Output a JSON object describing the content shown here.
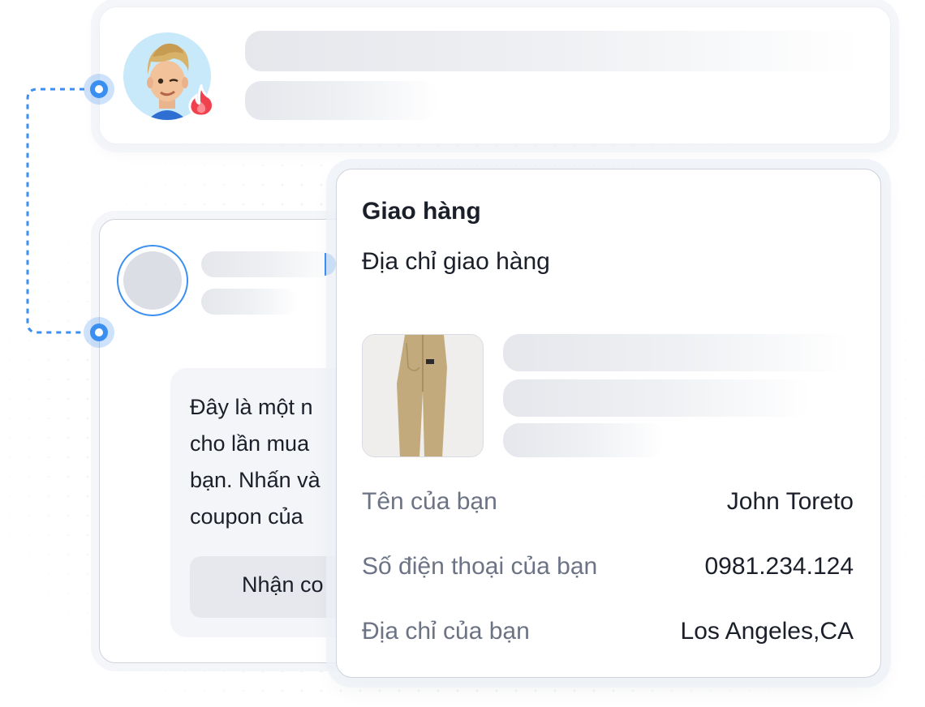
{
  "colors": {
    "accent": "#3b8ff0",
    "avatar_bg": "#c7e9f9",
    "fire": "#f0424e",
    "text_primary": "#1b1f2a",
    "text_muted": "#6b7385"
  },
  "chat_message": {
    "lines": [
      "Đây là một n",
      "cho lần mua",
      "bạn. Nhấn và",
      "coupon của"
    ],
    "button_label": "Nhận co"
  },
  "delivery": {
    "title": "Giao hàng",
    "subtitle": "Địa chỉ giao hàng",
    "product_image": "khaki-pants",
    "fields": [
      {
        "label": "Tên của bạn",
        "value": "John Toreto"
      },
      {
        "label": "Số điện thoại của bạn",
        "value": "0981.234.124"
      },
      {
        "label": "Địa chỉ của bạn",
        "value": "Los Angeles,CA"
      }
    ]
  },
  "icons": {
    "user_avatar": "memoji-avatar-icon",
    "badge": "fire-icon",
    "placeholder_avatar": "placeholder-avatar-icon",
    "connector": "connector-node-icon"
  }
}
